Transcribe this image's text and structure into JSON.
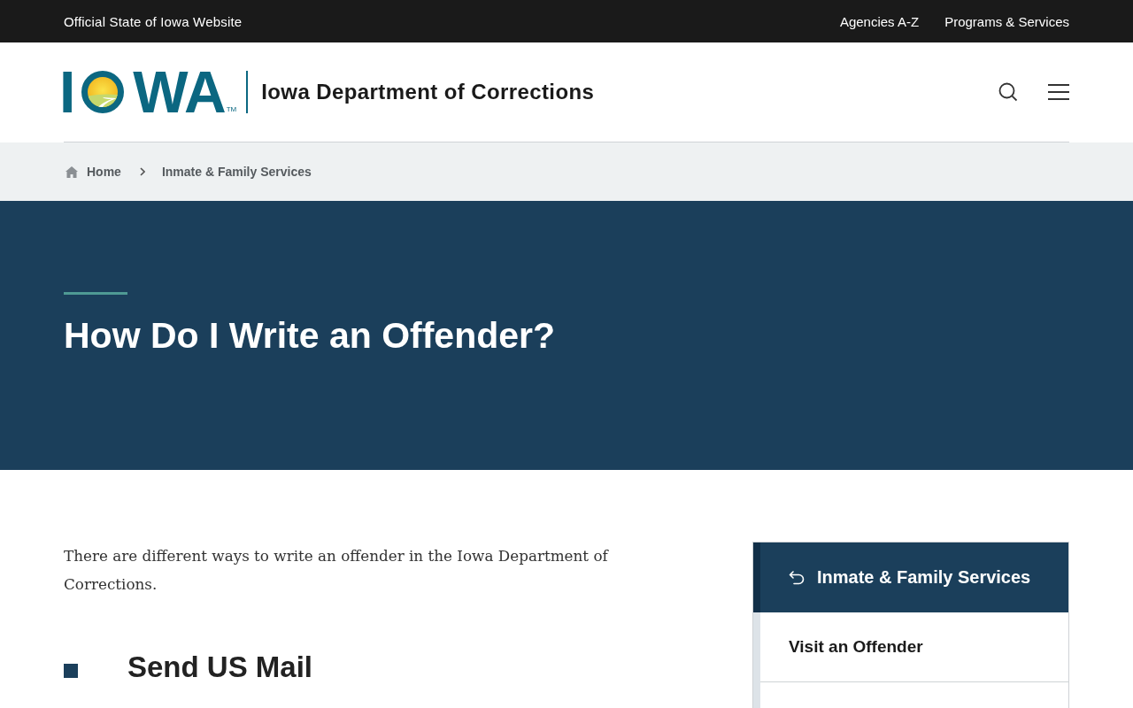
{
  "top_bar": {
    "title": "Official State of Iowa Website",
    "links": [
      "Agencies A-Z",
      "Programs & Services"
    ]
  },
  "header": {
    "logo": {
      "first_letter": "I",
      "last_letters": "WA",
      "trademark": "TM"
    },
    "site_title": "Iowa Department of Corrections"
  },
  "breadcrumb": [
    {
      "label": "Home",
      "kind": "home"
    },
    {
      "label": "Inmate & Family Services",
      "kind": "page"
    }
  ],
  "hero": {
    "title": "How Do I Write an Offender?"
  },
  "content": {
    "intro": "There are different ways to write an offender in the Iowa Department of Corrections.",
    "sections": [
      {
        "heading": "Send US Mail"
      }
    ]
  },
  "side_nav": {
    "parent": "Inmate & Family Services",
    "items": [
      {
        "label": "Visit an Offender"
      }
    ]
  }
}
